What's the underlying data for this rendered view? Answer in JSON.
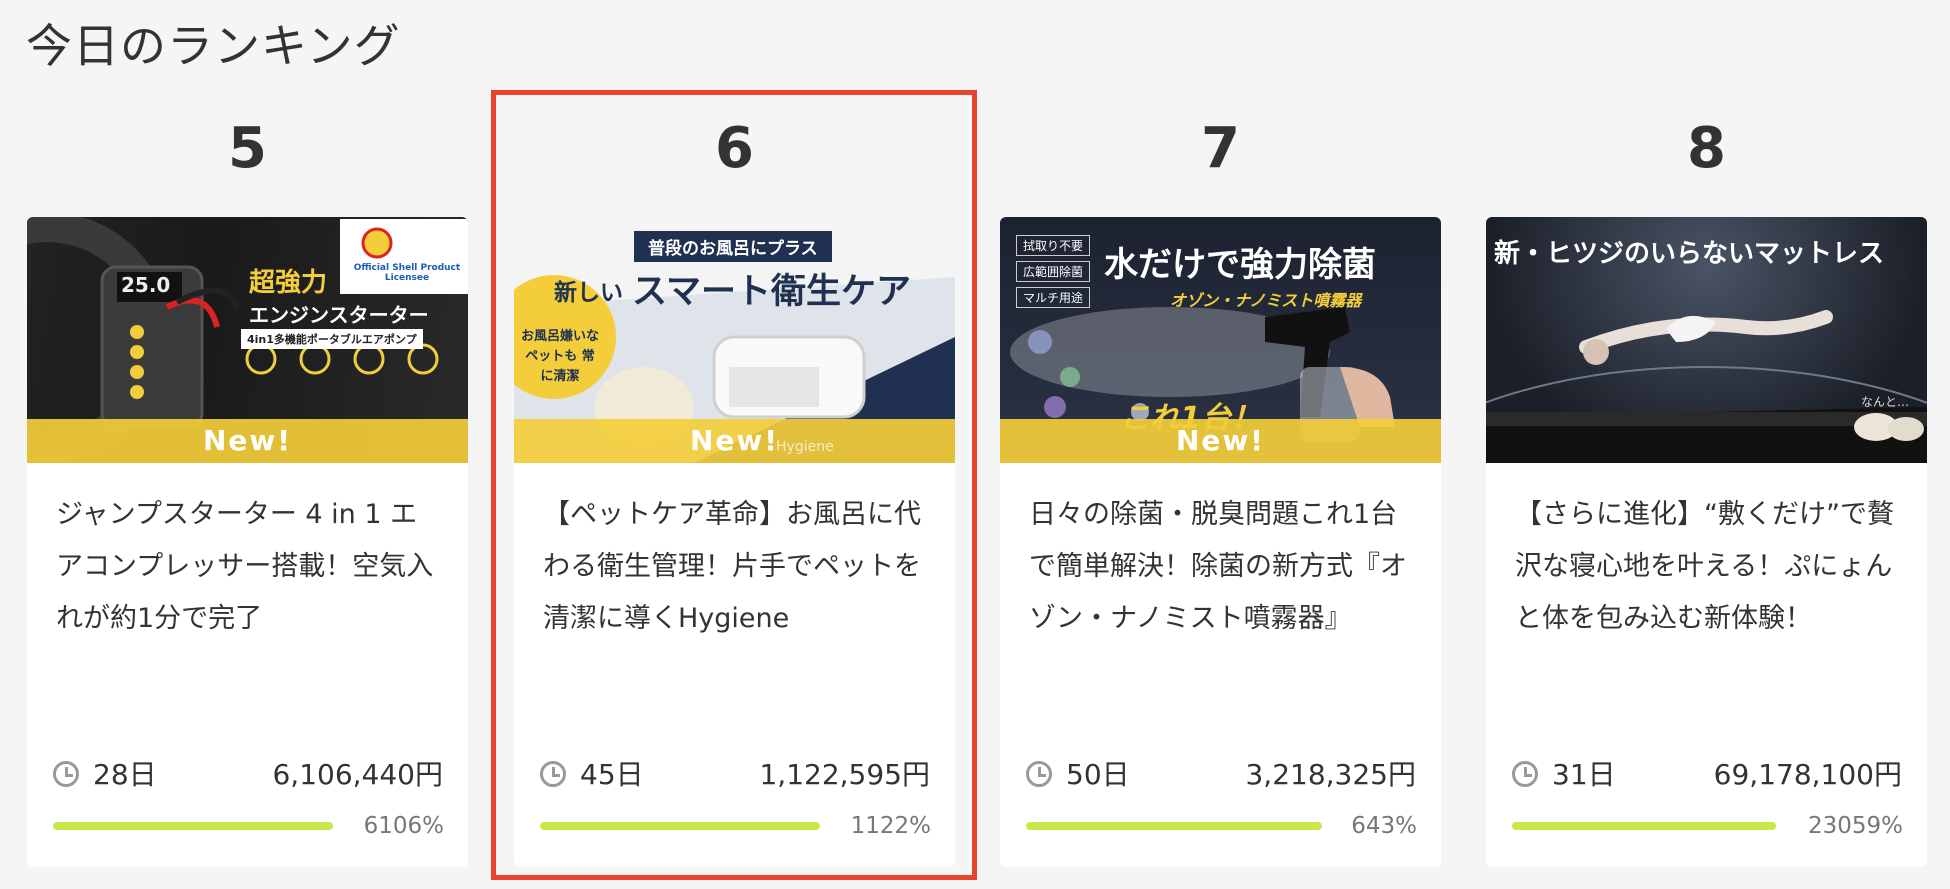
{
  "section_title": "今日のランキング",
  "accent": {
    "highlight": "#e8432c",
    "progress": "#c6e84b",
    "new_band": "#f3cd3a"
  },
  "items": [
    {
      "rank": "5",
      "badge": "New!",
      "thumb": {
        "headline": "超強力",
        "sub": "エンジンスターター",
        "tag": "4in1多機能ポータブルエアポンプ",
        "logo_text": "Official Shell Product Licensee",
        "display": "25.0"
      },
      "title": "ジャンプスターター 4 in 1 エアコンプレッサー搭載！空気入れが約1分で完了",
      "days": "28日",
      "amount": "6,106,440円",
      "percent": "6106%",
      "progress": 1.0
    },
    {
      "rank": "6",
      "badge": "New!",
      "thumb": {
        "banner": "普段のお風呂にプラス",
        "headline_pre": "新しい",
        "headline": "スマート衛生ケア",
        "bubble": "お風呂嫌いな ペットも 常に清潔",
        "brand": "Hygiene"
      },
      "title": "【ペットケア革命】お風呂に代わる衛生管理！片手でペットを清潔に導くHygiene",
      "days": "45日",
      "amount": "1,122,595円",
      "percent": "1122%",
      "progress": 1.0
    },
    {
      "rank": "7",
      "badge": "New!",
      "thumb": {
        "tags": [
          "拭取り不要",
          "広範囲除菌",
          "マルチ用途"
        ],
        "headline": "水だけで強力除菌",
        "sub": "オゾン・ナノミスト噴霧器",
        "corner": "これ1台！"
      },
      "title": "日々の除菌・脱臭問題これ1台で簡単解決！除菌の新方式『オゾン・ナノミスト噴霧器』",
      "days": "50日",
      "amount": "3,218,325円",
      "percent": "643%",
      "progress": 1.0
    },
    {
      "rank": "8",
      "badge": "",
      "thumb": {
        "headline": "新・ヒツジのいらないマットレス",
        "note": "なんと…"
      },
      "title": "【さらに進化】“敷くだけ”で贅沢な寝心地を叶える！ぷにょんと体を包み込む新体験！",
      "days": "31日",
      "amount": "69,178,100円",
      "percent": "23059%",
      "progress": 1.0
    }
  ]
}
